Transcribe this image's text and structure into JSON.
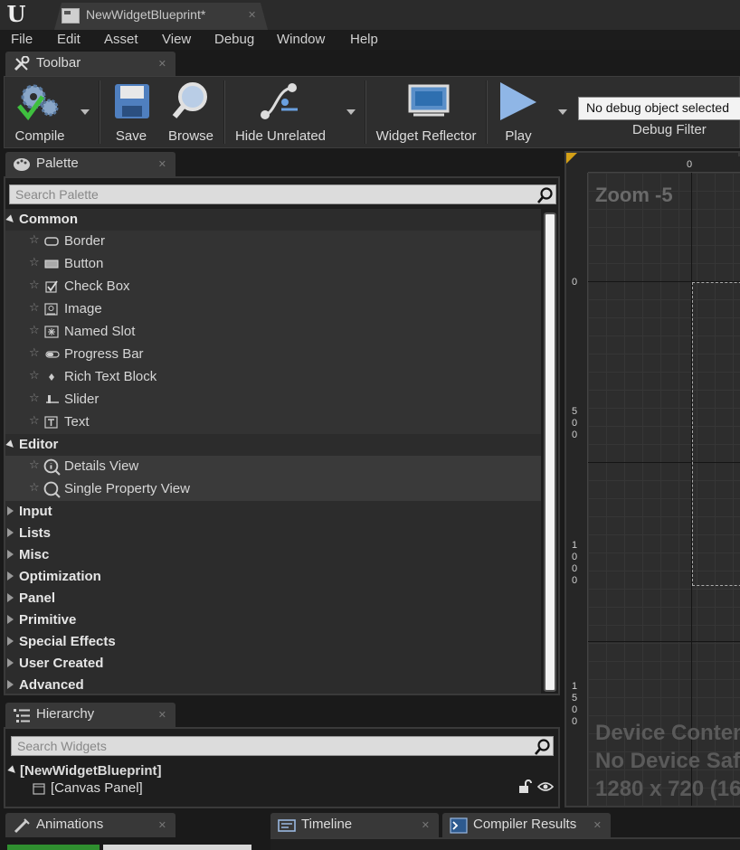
{
  "window": {
    "logo_text": "U",
    "doc_tab": "NewWidgetBlueprint*"
  },
  "menu": [
    "File",
    "Edit",
    "Asset",
    "View",
    "Debug",
    "Window",
    "Help"
  ],
  "toolbar": {
    "tab_label": "Toolbar",
    "buttons": {
      "compile": "Compile",
      "save": "Save",
      "browse": "Browse",
      "hide_unrelated": "Hide Unrelated",
      "widget_reflector": "Widget Reflector",
      "play": "Play"
    },
    "debug_select": "No debug object selected",
    "debug_filter": "Debug Filter"
  },
  "palette": {
    "tab_label": "Palette",
    "search_placeholder": "Search Palette",
    "common": {
      "label": "Common",
      "items": [
        "Border",
        "Button",
        "Check Box",
        "Image",
        "Named Slot",
        "Progress Bar",
        "Rich Text Block",
        "Slider",
        "Text"
      ]
    },
    "editor": {
      "label": "Editor",
      "items": [
        "Details View",
        "Single Property View"
      ]
    },
    "collapsed": [
      "Input",
      "Lists",
      "Misc",
      "Optimization",
      "Panel",
      "Primitive",
      "Special Effects",
      "User Created",
      "Advanced"
    ]
  },
  "hierarchy": {
    "tab_label": "Hierarchy",
    "search_placeholder": "Search Widgets",
    "root": "[NewWidgetBlueprint]",
    "child": "[Canvas Panel]"
  },
  "designer": {
    "zoom": "Zoom -5",
    "ruler_top": "0",
    "ruler_left": [
      "0",
      "5\n0\n0",
      "1\n0\n0\n0",
      "1\n5\n0\n0"
    ],
    "device_content": "Device Content",
    "device_safe": "No Device Safe",
    "resolution": "1280 x 720 (16"
  },
  "bottom_tabs": {
    "animations": "Animations",
    "timeline": "Timeline",
    "compiler_results": "Compiler Results"
  },
  "colors": {
    "accent": "#2f8f2f",
    "panel": "#2e2e2e",
    "background": "#1a1a1a"
  }
}
